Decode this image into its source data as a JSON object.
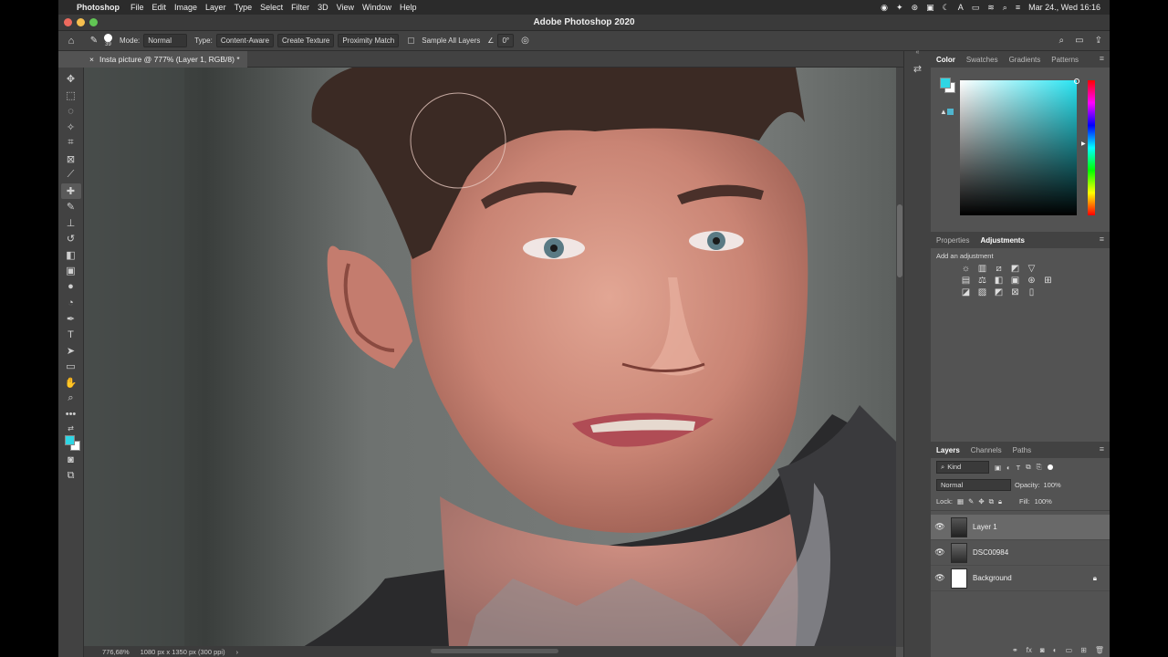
{
  "menubar": {
    "apple_icon": "apple-icon",
    "app_name": "Photoshop",
    "items": [
      "File",
      "Edit",
      "Image",
      "Layer",
      "Type",
      "Select",
      "Filter",
      "3D",
      "View",
      "Window",
      "Help"
    ],
    "clock": "Mar 24., Wed  16:16"
  },
  "window": {
    "title": "Adobe Photoshop 2020"
  },
  "options": {
    "brush_size": "39",
    "mode_label": "Mode:",
    "mode_value": "Normal",
    "type_label": "Type:",
    "type_options": [
      "Content-Aware",
      "Create Texture",
      "Proximity Match"
    ],
    "sample_all_layers": "Sample All Layers",
    "angle": "0°"
  },
  "document": {
    "tab_title": "Insta picture @ 777% (Layer 1, RGB/8) *",
    "zoom": "776,68%",
    "doc_info": "1080 px x 1350 px (300 ppi)"
  },
  "color_panel": {
    "tabs": [
      "Color",
      "Swatches",
      "Gradients",
      "Patterns"
    ],
    "active": "Color",
    "foreground": "#2fd6e4",
    "background": "#ffffff"
  },
  "adjust_panel": {
    "tabs": [
      "Properties",
      "Adjustments"
    ],
    "active": "Adjustments",
    "hint": "Add an adjustment"
  },
  "layers_panel": {
    "tabs": [
      "Layers",
      "Channels",
      "Paths"
    ],
    "active": "Layers",
    "filter": "Kind",
    "blend_mode": "Normal",
    "opacity_label": "Opacity:",
    "opacity": "100%",
    "lock_label": "Lock:",
    "fill_label": "Fill:",
    "fill": "100%",
    "layers": [
      {
        "name": "Layer 1",
        "selected": true
      },
      {
        "name": "DSC00984",
        "selected": false
      },
      {
        "name": "Background",
        "selected": false,
        "locked": true
      }
    ]
  }
}
